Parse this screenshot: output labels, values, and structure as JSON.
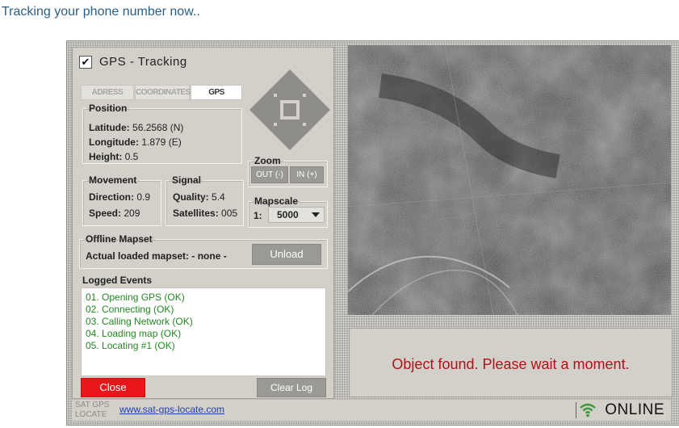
{
  "page": {
    "heading": "Tracking your phone number now.."
  },
  "panel": {
    "title": "GPS - Tracking",
    "tabs": [
      {
        "label": "ADRESS",
        "active": false
      },
      {
        "label": "COORDINATES",
        "active": false
      },
      {
        "label": "GPS",
        "active": true
      }
    ],
    "position": {
      "legend": "Position",
      "latitude_label": "Latitude:",
      "latitude_value": "56.2568 (N)",
      "longitude_label": "Longitude:",
      "longitude_value": "1.879 (E)",
      "height_label": "Height:",
      "height_value": "0.5"
    },
    "movement": {
      "legend": "Movement",
      "direction_label": "Direction:",
      "direction_value": "0.9",
      "speed_label": "Speed:",
      "speed_value": "209"
    },
    "signal": {
      "legend": "Signal",
      "quality_label": "Quality:",
      "quality_value": "5.4",
      "satellites_label": "Satellites:",
      "satellites_value": "005"
    },
    "zoom": {
      "legend": "Zoom",
      "out_label": "OUT (-)",
      "in_label": "IN (+)"
    },
    "mapscale": {
      "legend": "Mapscale",
      "prefix": "1:",
      "selected": "5000"
    },
    "offline_mapset": {
      "legend": "Offline Mapset",
      "label": "Actual loaded mapset:",
      "value": "- none -",
      "unload_label": "Unload"
    },
    "logged_events": {
      "legend": "Logged Events",
      "items": [
        "01. Opening GPS (OK)",
        "02. Connecting (OK)",
        "03. Calling Network (OK)",
        "04. Loading map (OK)",
        "05. Locating #1 (OK)"
      ]
    },
    "close_label": "Close",
    "clear_log_label": "Clear Log"
  },
  "message": "Object found. Please wait a moment.",
  "footer": {
    "logo_line1": "SAT GPS",
    "logo_line2": "LOCATE",
    "link": "www.sat-gps-locate.com",
    "status": "ONLINE"
  },
  "colors": {
    "accent_red": "#e8161b",
    "message_red": "#b3101a",
    "log_green": "#228822",
    "link_blue": "#1f3fb0"
  },
  "icons": [
    "checkbox-checked-icon",
    "direction-arrows-icon",
    "dropdown-arrow-icon",
    "wifi-signal-icon"
  ]
}
